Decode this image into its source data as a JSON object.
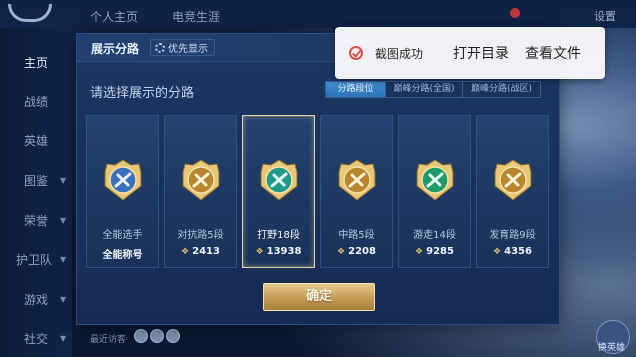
{
  "topnav": {
    "tabs": [
      "个人主页",
      "电竞生涯"
    ],
    "settings_label": "设置"
  },
  "sidebar": {
    "items": [
      {
        "label": "主页",
        "active": true
      },
      {
        "label": "战绩",
        "active": false
      },
      {
        "label": "英雄",
        "active": false
      },
      {
        "label": "图鉴",
        "active": false,
        "expandable": true
      },
      {
        "label": "荣誉",
        "active": false,
        "expandable": true
      },
      {
        "label": "护卫队",
        "active": false,
        "expandable": true
      },
      {
        "label": "游戏",
        "active": false,
        "expandable": true
      },
      {
        "label": "社交",
        "active": false,
        "expandable": true
      }
    ]
  },
  "modal": {
    "title": "展示分路",
    "priority_label": "优先显示",
    "subtitle": "请选择展示的分路",
    "segments": [
      {
        "label": "分路段位",
        "active": true
      },
      {
        "label": "巅峰分路(全国)",
        "active": false
      },
      {
        "label": "巅峰分路(战区)",
        "active": false
      }
    ],
    "cards": [
      {
        "name": "全能选手",
        "value": "全能称号",
        "icon": "all-round-badge-icon",
        "selected": false,
        "show_coin": false
      },
      {
        "name": "对抗路5段",
        "value": "2413",
        "icon": "clash-lane-badge-icon",
        "selected": false,
        "show_coin": true
      },
      {
        "name": "打野18段",
        "value": "13938",
        "icon": "jungle-badge-icon",
        "selected": true,
        "show_coin": true
      },
      {
        "name": "中路5段",
        "value": "2208",
        "icon": "mid-lane-badge-icon",
        "selected": false,
        "show_coin": true
      },
      {
        "name": "游走14段",
        "value": "9285",
        "icon": "roam-badge-icon",
        "selected": false,
        "show_coin": true
      },
      {
        "name": "发育路9段",
        "value": "4356",
        "icon": "farm-lane-badge-icon",
        "selected": false,
        "show_coin": true
      }
    ],
    "confirm_label": "确定"
  },
  "toast": {
    "message": "截图成功",
    "open_dir_label": "打开目录",
    "view_file_label": "查看文件"
  },
  "bottom": {
    "recent_label": "最近访客",
    "right_button_label": "换英雄"
  },
  "colors": {
    "panel_bg": "#1c3763",
    "accent_blue": "#3e8ed3",
    "gold": "#c69c54",
    "toast_check": "#e24b4b"
  }
}
